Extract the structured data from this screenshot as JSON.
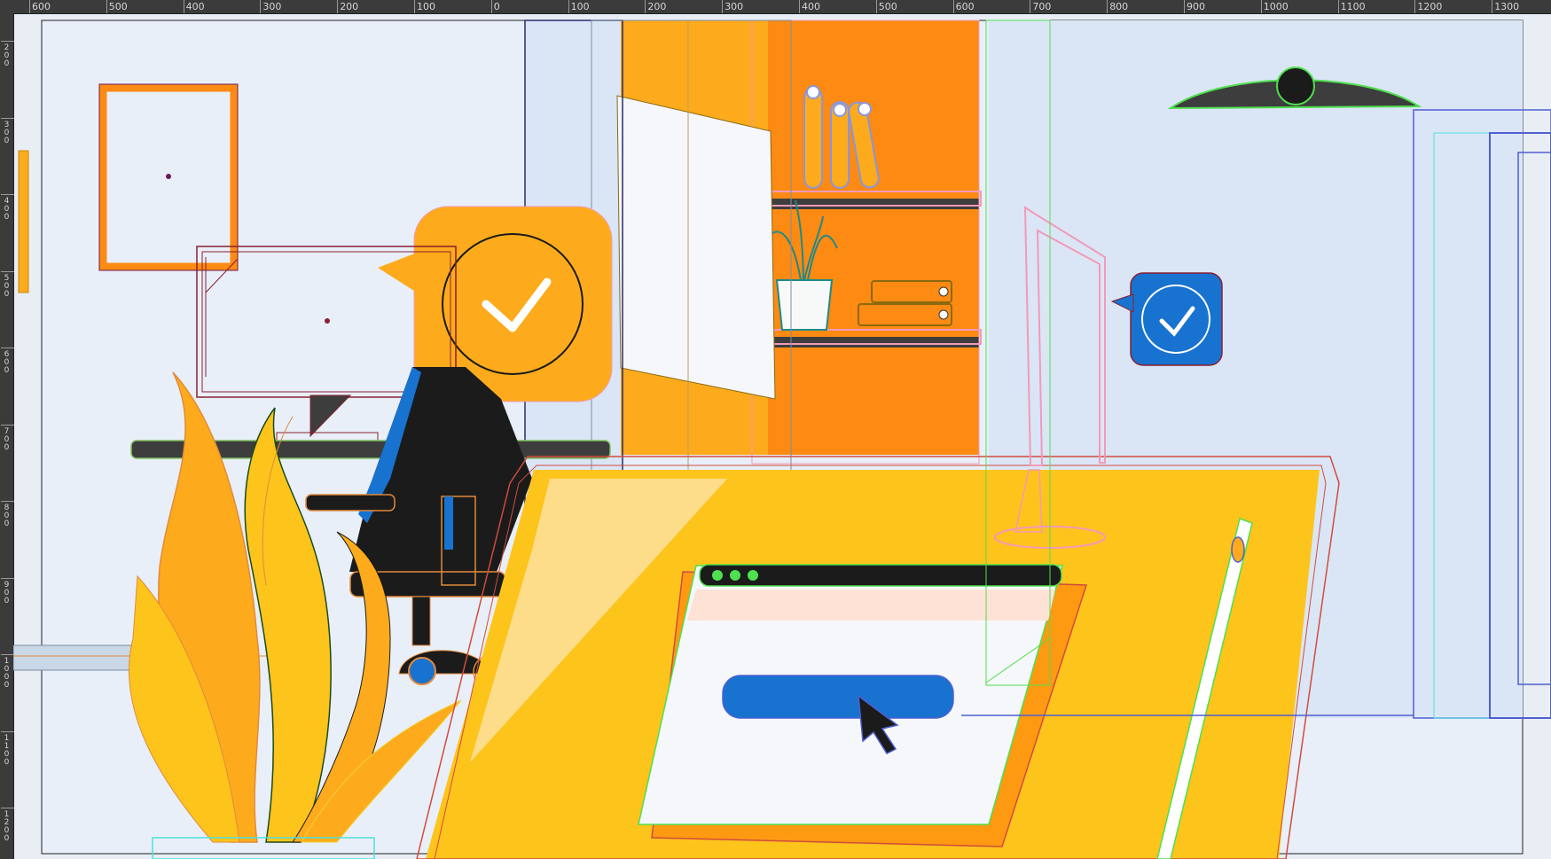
{
  "ruler": {
    "horizontal": [
      "600",
      "500",
      "400",
      "300",
      "200",
      "100",
      "0",
      "100",
      "200",
      "300",
      "400",
      "500",
      "600",
      "700",
      "800",
      "900",
      "1000",
      "1100",
      "1200",
      "1300"
    ],
    "vertical": [
      "2\n0\n0",
      "3\n0\n0",
      "4\n0\n0",
      "5\n0\n0",
      "6\n0\n0",
      "7\n0\n0",
      "8\n0\n0",
      "9\n0\n0",
      "1\n0\n0\n0",
      "1\n1\n0\n0",
      "1\n2\n0\n0"
    ]
  },
  "colors": {
    "canvas_bg": "#e9eef5",
    "artboard_bg": "#e8eff8",
    "wall_blue": "#dae6f6",
    "orange_dark": "#fd8a12",
    "orange": "#fdab1c",
    "yellow": "#fdc41c",
    "blue": "#1872d0",
    "black": "#1b1b1b",
    "screen_white": "#f6f7fb",
    "selection_green": "#4ee04e",
    "selection_red": "#d24b3c",
    "selection_blue": "#4f5fd2",
    "selection_pink": "#f29ab8"
  },
  "icons": [
    "check-bubble-icon",
    "cursor-arrow-icon",
    "anchor-point-icon"
  ]
}
